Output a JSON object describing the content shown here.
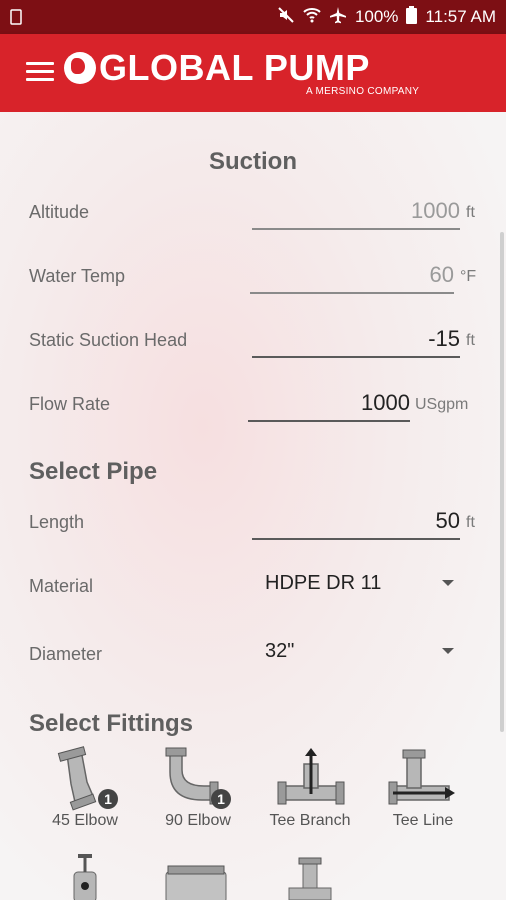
{
  "status_bar": {
    "time": "11:57 AM",
    "battery": "100%"
  },
  "app_bar": {
    "brand": "GLOBAL PUMP",
    "tagline": "A MERSINO COMPANY"
  },
  "suction": {
    "title": "Suction",
    "altitude": {
      "label": "Altitude",
      "value": "1000",
      "unit": "ft"
    },
    "water_temp": {
      "label": "Water Temp",
      "value": "60",
      "unit": "°F"
    },
    "static_head": {
      "label": "Static Suction Head",
      "value": "-15",
      "unit": "ft"
    },
    "flow_rate": {
      "label": "Flow Rate",
      "value": "1000",
      "unit": "USgpm"
    }
  },
  "pipe": {
    "title": "Select Pipe",
    "length": {
      "label": "Length",
      "value": "50",
      "unit": "ft"
    },
    "material": {
      "label": "Material",
      "value": "HDPE DR 11"
    },
    "diameter": {
      "label": "Diameter",
      "value": "32\""
    }
  },
  "fittings": {
    "title": "Select Fittings",
    "items": [
      {
        "label": "45 Elbow",
        "count": "1"
      },
      {
        "label": "90 Elbow",
        "count": "1"
      },
      {
        "label": "Tee Branch"
      },
      {
        "label": "Tee Line"
      }
    ]
  }
}
